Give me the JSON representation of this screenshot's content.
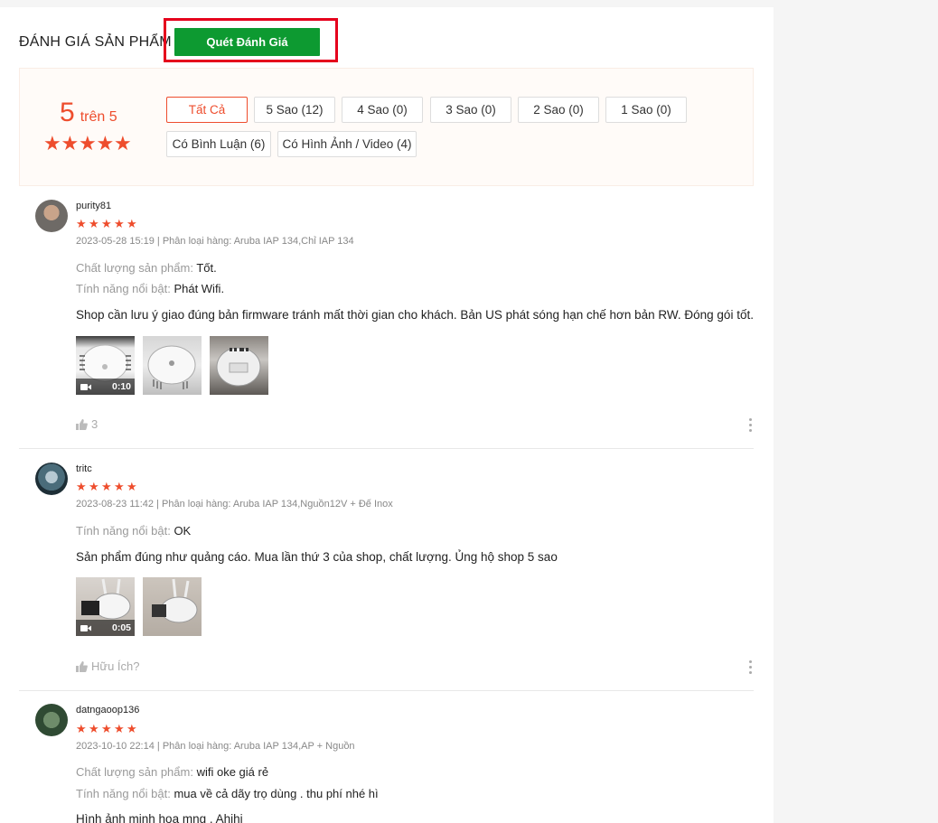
{
  "header": {
    "title": "ĐÁNH GIÁ SẢN PHẨM",
    "scan_button": "Quét Đánh Giá"
  },
  "overview": {
    "score": "5",
    "score_suffix": "trên 5",
    "rating_stars": 5,
    "filters": [
      {
        "label": "Tất Cả",
        "active": true
      },
      {
        "label": "5 Sao (12)",
        "active": false
      },
      {
        "label": "4 Sao (0)",
        "active": false
      },
      {
        "label": "3 Sao (0)",
        "active": false
      },
      {
        "label": "2 Sao (0)",
        "active": false
      },
      {
        "label": "1 Sao (0)",
        "active": false
      },
      {
        "label": "Có Bình Luận (6)",
        "active": false
      },
      {
        "label": "Có Hình Ảnh / Video (4)",
        "active": false
      }
    ]
  },
  "reviews": [
    {
      "username": "purity81",
      "stars": 5,
      "meta": "2023-05-28 15:19 | Phân loại hàng: Aruba IAP 134,Chỉ IAP 134",
      "attributes": [
        {
          "key": "Chất lượng sản phẩm:",
          "value": "Tốt."
        },
        {
          "key": "Tính năng nổi bật:",
          "value": "Phát Wifi."
        }
      ],
      "comment": "Shop cần lưu ý giao đúng bản firmware tránh mất thời gian cho khách. Bản US phát sóng hạn chế hơn bản RW. Đóng gói tốt.",
      "video_duration": "0:10",
      "likes": "3"
    },
    {
      "username": "tritc",
      "stars": 5,
      "meta": "2023-08-23 11:42 | Phân loại hàng: Aruba IAP 134,Nguồn12V + Đế Inox",
      "attributes": [
        {
          "key": "Tính năng nổi bật:",
          "value": "OK"
        }
      ],
      "comment": "Sản phẩm đúng như quảng cáo. Mua lần thứ 3 của shop, chất lượng. Ủng hộ shop 5 sao",
      "video_duration": "0:05",
      "likes": "Hữu Ích?"
    },
    {
      "username": "datngaoop136",
      "stars": 5,
      "meta": "2023-10-10 22:14 | Phân loại hàng: Aruba IAP 134,AP + Nguồn",
      "attributes": [
        {
          "key": "Chất lượng sản phẩm:",
          "value": "wifi oke giá rẻ"
        },
        {
          "key": "Tính năng nổi bật:",
          "value": "mua về cả dãy trọ dùng . thu phí nhé hì"
        }
      ],
      "comment": "Hình ảnh minh họa mng . Ahihi"
    }
  ],
  "colors": {
    "accent": "#ee4d2d",
    "scan_button_bg": "#0d9a31",
    "highlight_border": "#e5001c"
  },
  "icons": {
    "rating_star": "star-icon",
    "like": "thumbs-up-icon",
    "video": "video-camera-icon",
    "more": "more-vertical-icon"
  }
}
